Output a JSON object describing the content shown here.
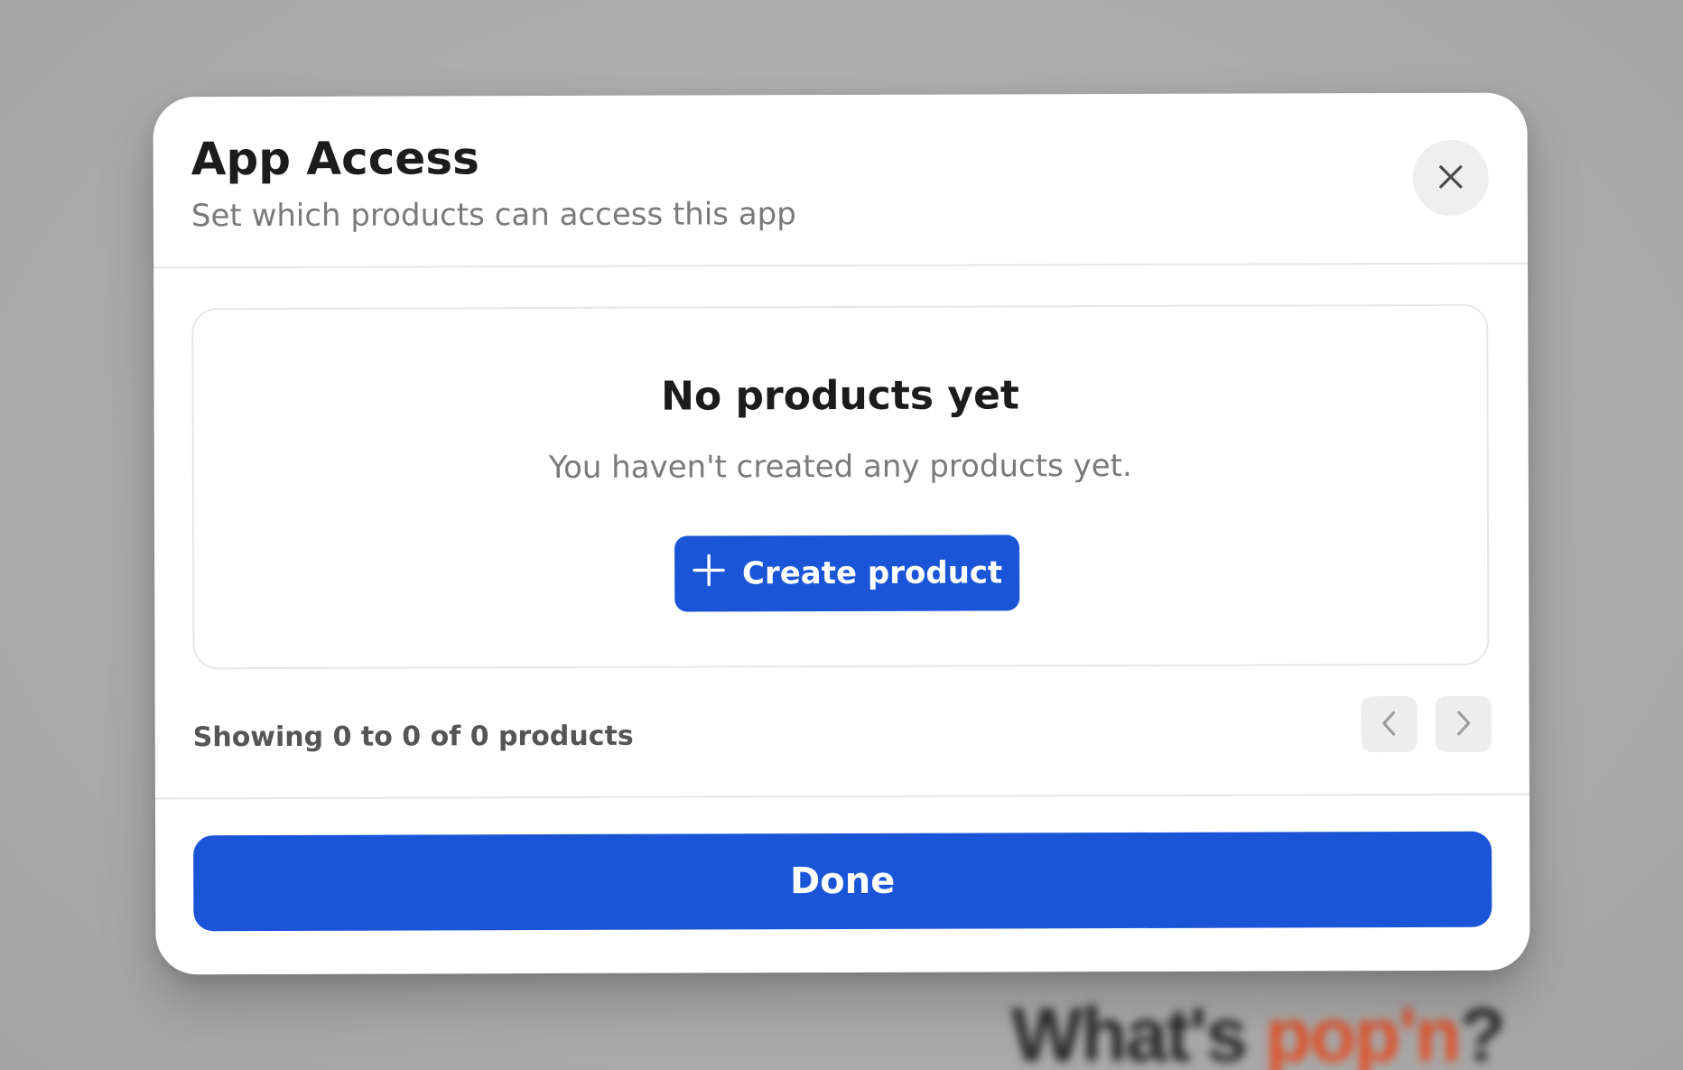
{
  "background": {
    "brand_text_main": "What's ",
    "brand_text_accent": "pop'n",
    "brand_text_end": "?"
  },
  "modal": {
    "title": "App Access",
    "subtitle": "Set which products can access this app",
    "close_icon": "close-icon"
  },
  "empty_state": {
    "title": "No products yet",
    "message": "You haven't created any products yet.",
    "create_button_label": "Create product",
    "create_button_icon": "plus-icon"
  },
  "pagination": {
    "summary": "Showing 0 to 0 of 0 products",
    "prev_icon": "chevron-left-icon",
    "next_icon": "chevron-right-icon"
  },
  "footer": {
    "done_label": "Done"
  },
  "colors": {
    "primary": "#1a55d8",
    "overlay": "#adadad",
    "brand_accent": "#e0522b"
  }
}
